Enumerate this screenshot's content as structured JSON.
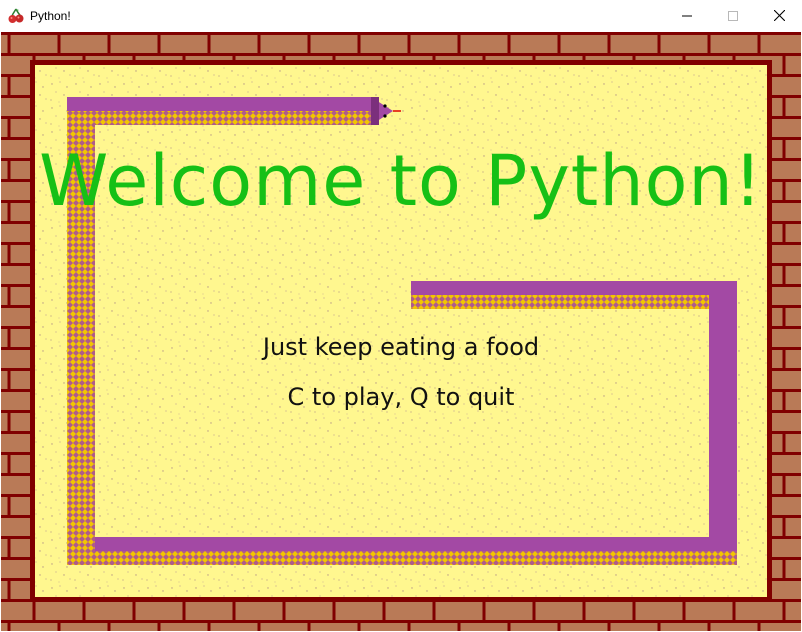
{
  "window": {
    "title": "Python!",
    "icon": "cherry-icon",
    "controls": [
      "minimize-icon",
      "maximize-icon",
      "close-icon"
    ]
  },
  "game": {
    "title": "Welcome to Python!",
    "subtitle": "Just keep eating a food",
    "instructions": "C to play, Q to quit"
  },
  "colors": {
    "brick": "#b97a57",
    "mortar": "#800000",
    "field": "#fff78f",
    "title_text": "#16c016",
    "snake_body": "#a349a4",
    "snake_pattern": "#f2c500",
    "snake_tongue": "#e00000"
  }
}
